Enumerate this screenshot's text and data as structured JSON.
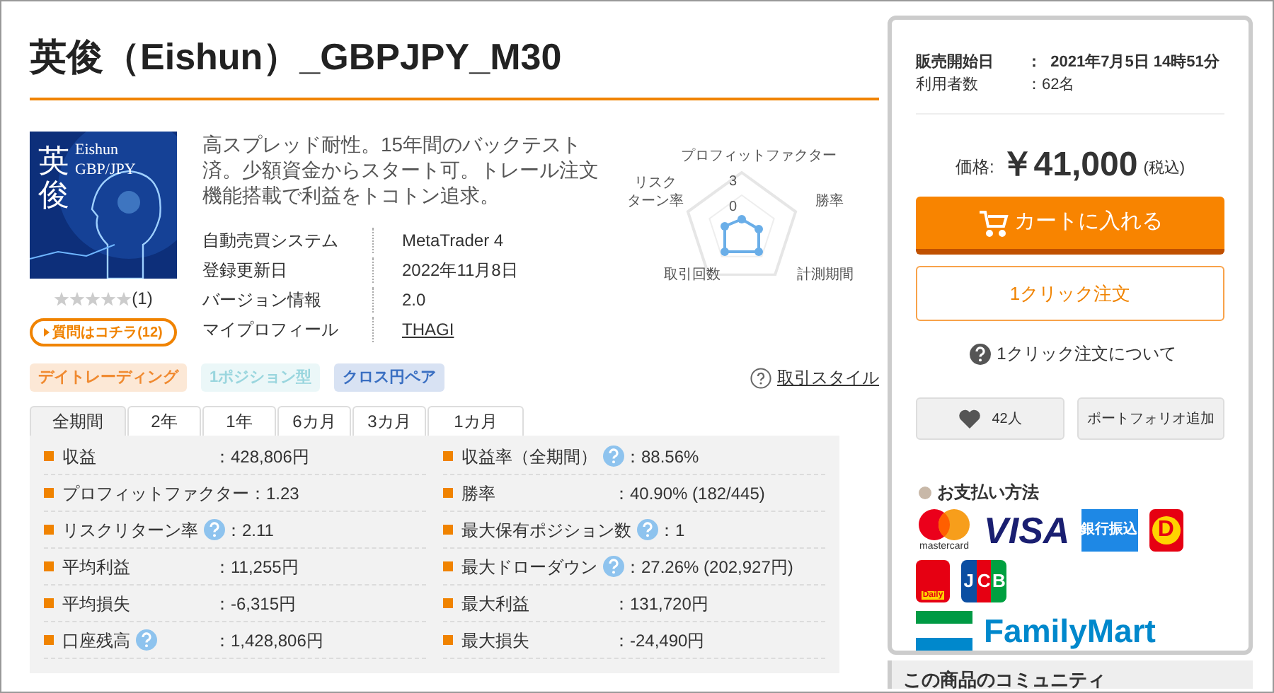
{
  "title": "英俊（Eishun）_GBPJPY_M30",
  "product": {
    "image_title": "英俊",
    "image_subtitle": "Eishun",
    "image_pair": "GBP/JPY",
    "stars": 0,
    "review_count": "(1)",
    "question_button": "質問はコチラ(12)"
  },
  "description": "高スプレッド耐性。15年間のバックテスト済。少額資金からスタート可。トレール注文機能搭載で利益をトコトン追求。",
  "specs": [
    {
      "label": "自動売買システム",
      "value": "MetaTrader 4",
      "kind": "text"
    },
    {
      "label": "登録更新日",
      "value": "2022年11月8日",
      "kind": "text"
    },
    {
      "label": "バージョン情報",
      "value": "2.0",
      "kind": "text"
    },
    {
      "label": "マイプロフィール",
      "value": "THAGI",
      "kind": "link"
    }
  ],
  "radar": {
    "axes": [
      "プロフィットファクター",
      "勝率",
      "計測期間",
      "取引回数"
    ],
    "left_axis_lines": [
      "リスク",
      "ターン率"
    ],
    "tick_high": "3",
    "tick_low": "0"
  },
  "tags": [
    {
      "label": "デイトレーディング",
      "color": "#f08a30"
    },
    {
      "label": "1ポジション型",
      "color": "#9ad6de"
    },
    {
      "label": "クロス円ペア",
      "color": "#3a6fc2"
    }
  ],
  "style_link": "取引スタイル",
  "tabs": [
    {
      "label": "全期間",
      "selected": true
    },
    {
      "label": "2年",
      "selected": false
    },
    {
      "label": "1年",
      "selected": false
    },
    {
      "label": "6カ月",
      "selected": false
    },
    {
      "label": "3カ月",
      "selected": false
    },
    {
      "label": "1カ月",
      "selected": false
    }
  ],
  "stats_left": [
    {
      "label": "収益",
      "value": "：428,806円",
      "help": false
    },
    {
      "label": "プロフィットファクター",
      "value": "：1.23",
      "help": false
    },
    {
      "label": "リスクリターン率",
      "value": "：2.11",
      "help": true
    },
    {
      "label": "平均利益",
      "value": "：11,255円",
      "help": false
    },
    {
      "label": "平均損失",
      "value": "：-6,315円",
      "help": false
    },
    {
      "label": "口座残高",
      "value": "：1,428,806円",
      "help": true
    }
  ],
  "stats_right": [
    {
      "label": "収益率（全期間）",
      "value": "：88.56%",
      "help": true
    },
    {
      "label": "勝率",
      "value": "：40.90% (182/445)",
      "help": false
    },
    {
      "label": "最大保有ポジション数",
      "value": "：1",
      "help": true
    },
    {
      "label": "最大ドローダウン",
      "value": "：27.26% (202,927円)",
      "help": true
    },
    {
      "label": "最大利益",
      "value": "：131,720円",
      "help": false
    },
    {
      "label": "最大損失",
      "value": "：-24,490円",
      "help": false
    }
  ],
  "sidebar": {
    "info": [
      {
        "label": "販売開始日",
        "value": "：  2021年7月5日 14時51分",
        "bold": true
      },
      {
        "label": "利用者数",
        "value": "：62名",
        "bold": false
      }
    ],
    "price_label": "価格:",
    "price": "￥41,000",
    "tax": "(税込)",
    "cart_button": "カートに入れる",
    "one_click_button": "1クリック注文",
    "one_click_help": "1クリック注文について",
    "favorite_count": "42人",
    "portfolio_button": "ポートフォリオ追加",
    "payment_heading": "お支払い方法",
    "payments": [
      {
        "kind": "mastercard",
        "label": "mastercard"
      },
      {
        "kind": "visa",
        "label": "VISA"
      },
      {
        "kind": "bank",
        "label": "銀行振込"
      },
      {
        "kind": "daily",
        "label": "D"
      },
      {
        "kind": "daily2",
        "label": "Daily"
      },
      {
        "kind": "jcb",
        "label": "JCB"
      },
      {
        "kind": "famima",
        "label": "FamilyMart"
      }
    ],
    "community_heading": "この商品のコミュニティ"
  }
}
